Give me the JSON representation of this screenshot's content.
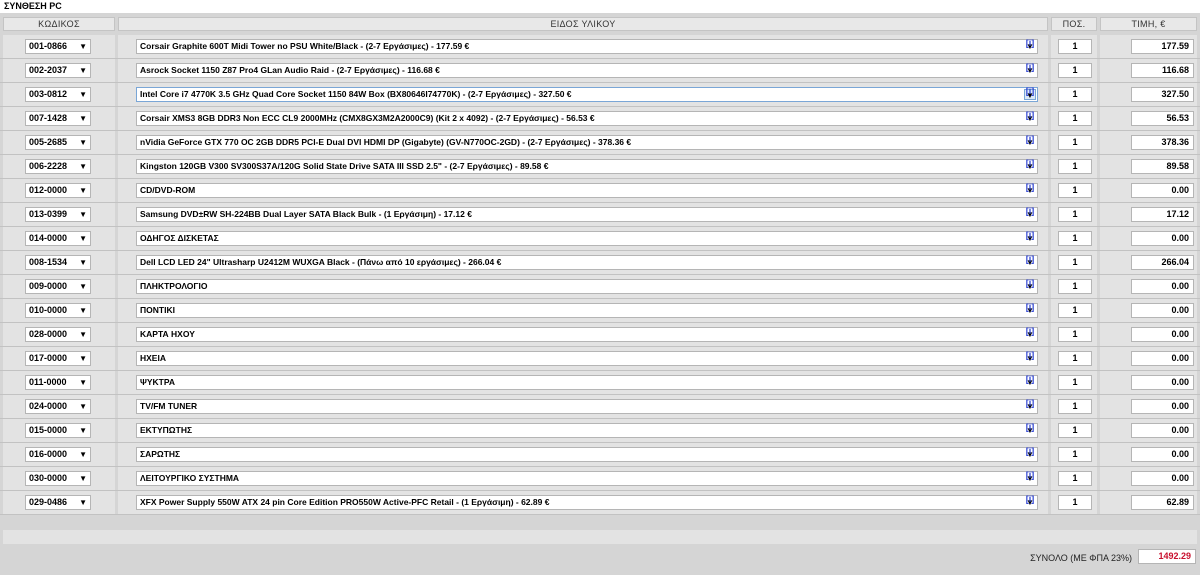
{
  "title": "ΣΥΝΘΕΣΗ PC",
  "headers": {
    "code": "ΚΩΔΙΚΟΣ",
    "item": "ΕΙΔΟΣ ΥΛΙΚΟΥ",
    "qty": "ΠΟΣ.",
    "price": "ΤΙΜΗ, €"
  },
  "info_glyph": "[i]",
  "rows": [
    {
      "code": "001-0866",
      "item": "Corsair Graphite 600T Midi Tower no PSU White/Black - (2-7 Εργάσιμες) - 177.59 €",
      "qty": "1",
      "price": "177.59"
    },
    {
      "code": "002-2037",
      "item": "Asrock Socket 1150 Z87 Pro4 GLan Audio Raid - (2-7 Εργάσιμες) - 116.68 €",
      "qty": "1",
      "price": "116.68"
    },
    {
      "code": "003-0812",
      "item": "Intel Core i7 4770K 3.5 GHz Quad Core Socket 1150 84W Box (BX80646I74770K) - (2-7 Εργάσιμες) - 327.50 €",
      "qty": "1",
      "price": "327.50"
    },
    {
      "code": "007-1428",
      "item": "Corsair XMS3 8GB DDR3 Non ECC CL9 2000MHz (CMX8GX3M2A2000C9) (Kit 2 x 4092) - (2-7 Εργάσιμες) - 56.53 €",
      "qty": "1",
      "price": "56.53"
    },
    {
      "code": "005-2685",
      "item": "nVidia GeForce GTX 770 OC 2GB DDR5 PCI-E Dual DVI HDMI DP (Gigabyte) (GV-N770OC-2GD) - (2-7 Εργάσιμες) - 378.36 €",
      "qty": "1",
      "price": "378.36"
    },
    {
      "code": "006-2228",
      "item": "Kingston 120GB V300 SV300S37A/120G Solid State Drive SATA III SSD 2.5\" - (2-7 Εργάσιμες) - 89.58 €",
      "qty": "1",
      "price": "89.58"
    },
    {
      "code": "012-0000",
      "item": "CD/DVD-ROM",
      "qty": "1",
      "price": "0.00"
    },
    {
      "code": "013-0399",
      "item": "Samsung DVD±RW SH-224BB Dual Layer SATA Black Bulk - (1 Εργάσιμη) - 17.12 €",
      "qty": "1",
      "price": "17.12"
    },
    {
      "code": "014-0000",
      "item": "ΟΔΗΓΟΣ ΔΙΣΚΕΤΑΣ",
      "qty": "1",
      "price": "0.00"
    },
    {
      "code": "008-1534",
      "item": "Dell LCD LED 24\" Ultrasharp U2412M WUXGA Black - (Πάνω από 10 εργάσιμες) - 266.04 €",
      "qty": "1",
      "price": "266.04"
    },
    {
      "code": "009-0000",
      "item": "ΠΛΗΚΤΡΟΛΟΓΙΟ",
      "qty": "1",
      "price": "0.00"
    },
    {
      "code": "010-0000",
      "item": "ΠΟΝΤΙΚΙ",
      "qty": "1",
      "price": "0.00"
    },
    {
      "code": "028-0000",
      "item": "ΚΑΡΤΑ ΗΧΟΥ",
      "qty": "1",
      "price": "0.00"
    },
    {
      "code": "017-0000",
      "item": "ΗΧΕΙΑ",
      "qty": "1",
      "price": "0.00"
    },
    {
      "code": "011-0000",
      "item": "ΨΥΚΤΡΑ",
      "qty": "1",
      "price": "0.00"
    },
    {
      "code": "024-0000",
      "item": "TV/FM TUNER",
      "qty": "1",
      "price": "0.00"
    },
    {
      "code": "015-0000",
      "item": "ΕΚΤΥΠΩΤΗΣ",
      "qty": "1",
      "price": "0.00"
    },
    {
      "code": "016-0000",
      "item": "ΣΑΡΩΤΗΣ",
      "qty": "1",
      "price": "0.00"
    },
    {
      "code": "030-0000",
      "item": "ΛΕΙΤΟΥΡΓΙΚΟ ΣΥΣΤΗΜΑ",
      "qty": "1",
      "price": "0.00"
    },
    {
      "code": "029-0486",
      "item": "XFX Power Supply 550W ATX 24 pin Core Edition PRO550W Active-PFC Retail - (1 Εργάσιμη) - 62.89 €",
      "qty": "1",
      "price": "62.89"
    }
  ],
  "focused_row": 2,
  "total": {
    "label": "ΣΥΝΟΛΟ (ΜΕ ΦΠΑ 23%)",
    "value": "1492.29",
    "color": "#c8102e"
  },
  "colors": {
    "panel_bg": "#d5d5d5",
    "cell_bg": "#e3e3e3",
    "info_link": "#2a3fd0"
  }
}
